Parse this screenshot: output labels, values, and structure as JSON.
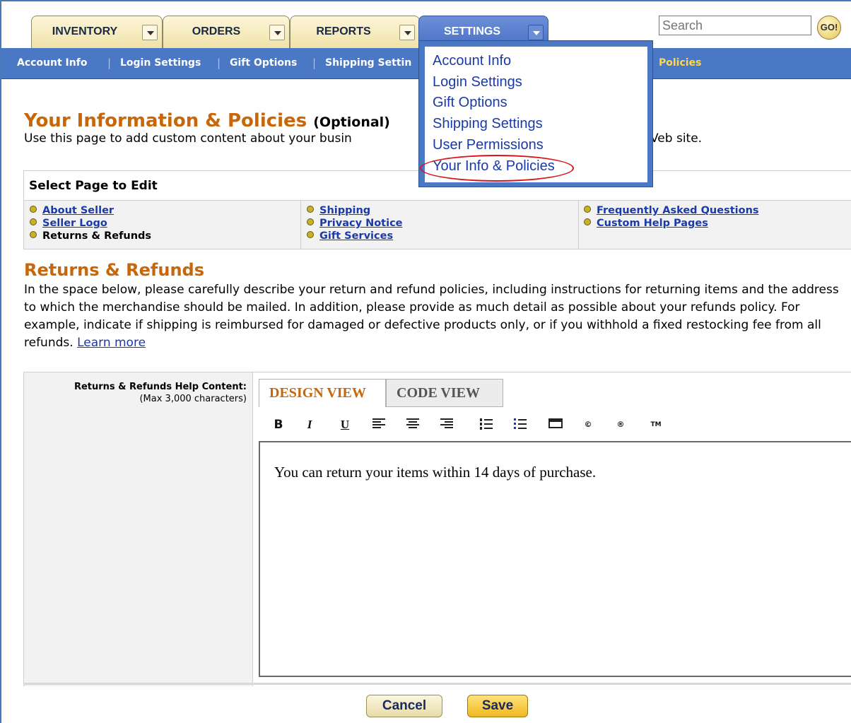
{
  "tabs": [
    {
      "label": "INVENTORY"
    },
    {
      "label": "ORDERS"
    },
    {
      "label": "REPORTS"
    },
    {
      "label": "SETTINGS"
    }
  ],
  "search": {
    "placeholder": "Search",
    "go_label": "GO!"
  },
  "subnav": {
    "items": [
      "Account Info",
      "Login Settings",
      "Gift Options",
      "Shipping Settin",
      "Policies"
    ]
  },
  "dropdown": {
    "items": [
      "Account Info",
      "Login Settings",
      "Gift Options",
      "Shipping Settings",
      "User Permissions",
      "Your Info & Policies"
    ]
  },
  "page": {
    "title": "Your Information & Policies",
    "title_suffix": "(Optional)",
    "intro_left": "Use this page to add custom content about your busin",
    "intro_right": "Veb site."
  },
  "select_box": {
    "heading": "Select Page to Edit",
    "col1": [
      "About Seller",
      "Seller Logo",
      "Returns & Refunds"
    ],
    "col2": [
      "Shipping",
      "Privacy Notice",
      "Gift Services"
    ],
    "col3": [
      "Frequently Asked Questions",
      "Custom Help Pages"
    ]
  },
  "section": {
    "title": "Returns & Refunds",
    "body": "In the space below, please carefully describe your return and refund policies, including instructions for returning items and the address to which the merchandise should be mailed. In addition, please provide as much detail as possible about your refunds policy. For example, indicate if shipping is reimbursed for damaged or defective products only, or if you withhold a fixed restocking fee from all refunds.",
    "learn_more": "Learn more"
  },
  "editor": {
    "label": "Returns & Refunds Help Content:",
    "sublabel": "(Max 3,000 characters)",
    "tab_design": "DESIGN VIEW",
    "tab_code": "CODE VIEW",
    "toolbar": {
      "bold": "B",
      "italic": "I",
      "underline": "U",
      "copyright": "©",
      "registered": "®",
      "trademark": "TM"
    },
    "content": "You can return your items within 14 days of purchase."
  },
  "buttons": {
    "cancel": "Cancel",
    "save": "Save"
  },
  "colors": {
    "accent_orange": "#c8660a",
    "nav_blue": "#4a78c4",
    "link_blue": "#1a3aa8",
    "highlight_red": "#d8141a"
  }
}
